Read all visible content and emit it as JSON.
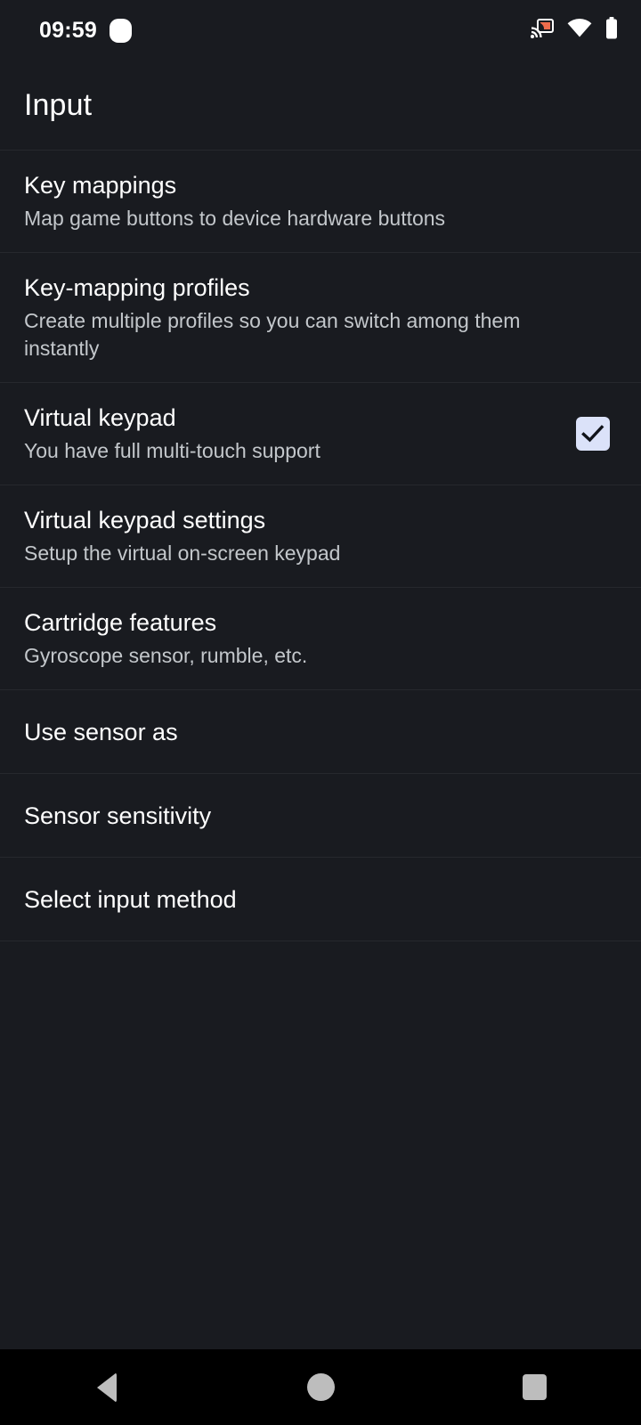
{
  "status_bar": {
    "time": "09:59",
    "notification_icon": "notification-dot-icon",
    "icons": [
      {
        "name": "cast-icon",
        "color": "#ee6c4d"
      },
      {
        "name": "wifi-icon",
        "color": "#ffffff"
      },
      {
        "name": "battery-icon",
        "color": "#ffffff"
      }
    ]
  },
  "header": {
    "title": "Input"
  },
  "colors": {
    "background": "#191b20",
    "divider": "#26282d",
    "primary_text": "#ffffff",
    "secondary_text": "#c3c7cb",
    "checkbox_fill": "#dbe2f9",
    "checkbox_mark": "#10131a",
    "nav_bar_background": "#000000",
    "nav_icon": "#bdbdbd",
    "cast_accent": "#ee6c4d"
  },
  "settings": {
    "rows": [
      {
        "title": "Key mappings",
        "summary": "Map game buttons to device hardware buttons",
        "widget": "none",
        "name": "pref-key-mappings"
      },
      {
        "title": "Key-mapping profiles",
        "summary": "Create multiple profiles so you can switch among them instantly",
        "widget": "none",
        "name": "pref-key-mapping-profiles"
      },
      {
        "title": "Virtual keypad",
        "summary": "You have full multi-touch support",
        "widget": "checkbox",
        "checked": true,
        "name": "pref-virtual-keypad"
      },
      {
        "title": "Virtual keypad settings",
        "summary": "Setup the virtual on-screen keypad",
        "widget": "none",
        "name": "pref-virtual-keypad-settings"
      },
      {
        "title": "Cartridge features",
        "summary": "Gyroscope sensor, rumble, etc.",
        "widget": "none",
        "name": "pref-cartridge-features"
      },
      {
        "title": "Use sensor as",
        "summary": "",
        "widget": "none",
        "name": "pref-use-sensor-as"
      },
      {
        "title": "Sensor sensitivity",
        "summary": "",
        "widget": "none",
        "name": "pref-sensor-sensitivity"
      },
      {
        "title": "Select input method",
        "summary": "",
        "widget": "none",
        "name": "pref-select-input-method"
      }
    ]
  },
  "nav_bar": {
    "buttons": [
      {
        "name": "nav-back-button",
        "icon": "back-triangle-icon"
      },
      {
        "name": "nav-home-button",
        "icon": "home-circle-icon"
      },
      {
        "name": "nav-recents-button",
        "icon": "recents-square-icon"
      }
    ]
  }
}
